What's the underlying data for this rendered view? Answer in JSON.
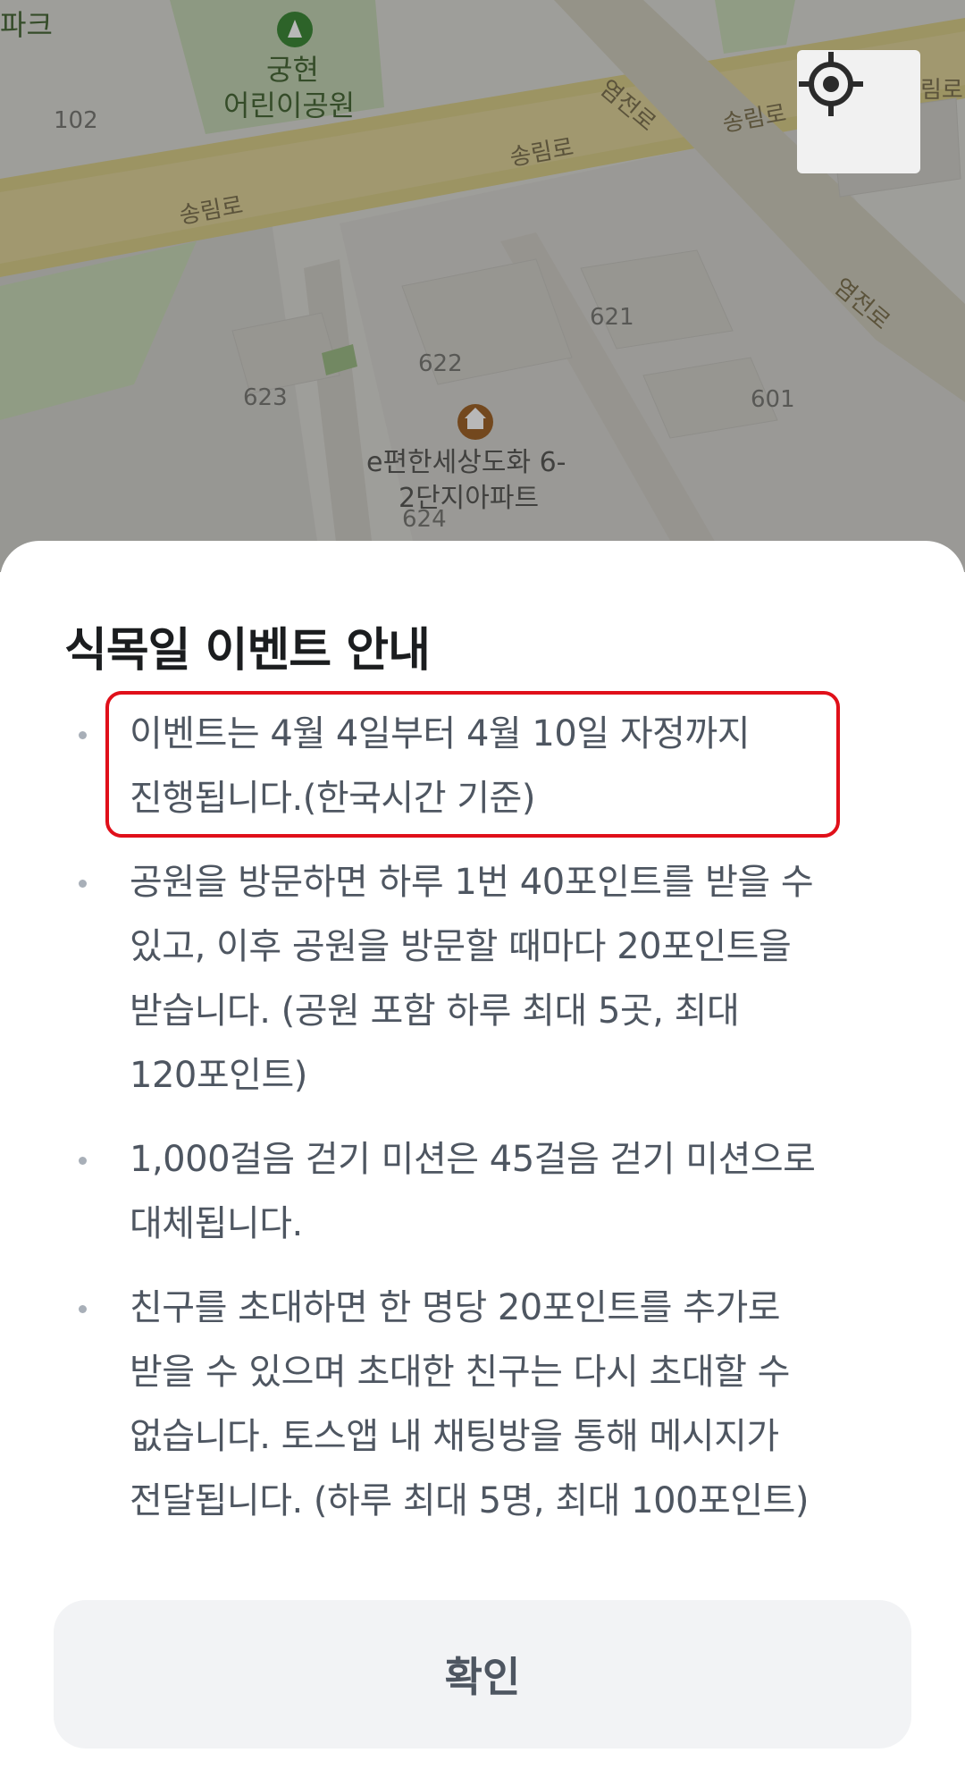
{
  "map": {
    "labels": {
      "park_name_left": "파크",
      "park_name_1": "궁현",
      "park_name_2": "어린이공원",
      "lot_102": "102",
      "lot_621": "621",
      "lot_622": "622",
      "lot_623": "623",
      "lot_601": "601",
      "lot_624": "624",
      "road_songnim_1": "송림로",
      "road_songnim_2": "송림로",
      "road_songnim_3": "송림로",
      "road_yeomjeon_1": "염전로",
      "road_yeomjeon_2": "염전로",
      "road_edge_right": "림로",
      "apt_line_1": "e편한세상도화 6-",
      "apt_line_2": "2단지아파트"
    },
    "park_icon": "park-pin-icon",
    "apartment_icon": "apartment-pin-icon",
    "locate_icon": "crosshair-icon"
  },
  "sheet": {
    "title": "식목일 이벤트 안내",
    "rules": [
      {
        "lines": [
          "이벤트는 4월 4일부터 4월 10일 자정까지",
          "진행됩니다.(한국시간 기준)"
        ],
        "highlighted": true
      },
      {
        "lines": [
          "공원을 방문하면 하루 1번 40포인트를 받을 수",
          "있고, 이후 공원을 방문할 때마다 20포인트을",
          "받습니다. (공원 포함 하루 최대 5곳, 최대",
          "120포인트)"
        ],
        "highlighted": false
      },
      {
        "lines": [
          "1,000걸음 걷기 미션은 45걸음 걷기 미션으로",
          "대체됩니다."
        ],
        "highlighted": false
      },
      {
        "lines": [
          "친구를 초대하면 한 명당 20포인트를 추가로",
          "받을 수 있으며 초대한 친구는 다시 초대할 수",
          "없습니다. 토스앱 내 채팅방을 통해 메시지가",
          "전달됩니다. (하루 최대 5명, 최대 100포인트)"
        ],
        "highlighted": false
      }
    ],
    "confirm_label": "확인",
    "highlight_color": "#e0101a"
  },
  "colors": {
    "map_road": "#d9c97b",
    "map_green": "#b8cfa7",
    "text_body": "#4e5661",
    "title": "#1b1d1f"
  }
}
